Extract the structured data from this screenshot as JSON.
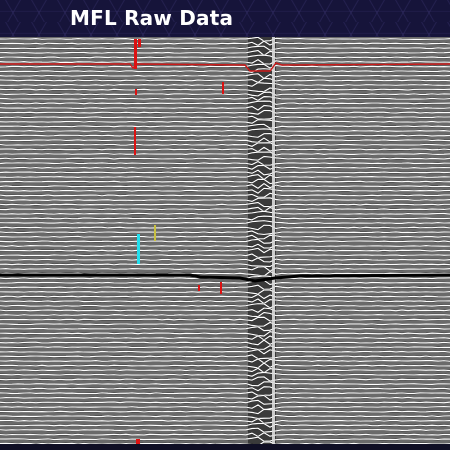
{
  "window": {
    "title": "MFL Raw Data"
  },
  "colors": {
    "background": "#0f0e24",
    "trace": "#ffffff",
    "trace_shadow": "#000000",
    "plot_background": "#6a6a6a",
    "reference_line": "#cc1a1a",
    "anomaly_red": "#dd1111",
    "anomaly_cyan": "#22e0ee",
    "anomaly_yellow": "#c8c040"
  },
  "icons": [
    "red-anomaly-marker",
    "cyan-anomaly-marker",
    "yellow-anomaly-marker"
  ]
}
